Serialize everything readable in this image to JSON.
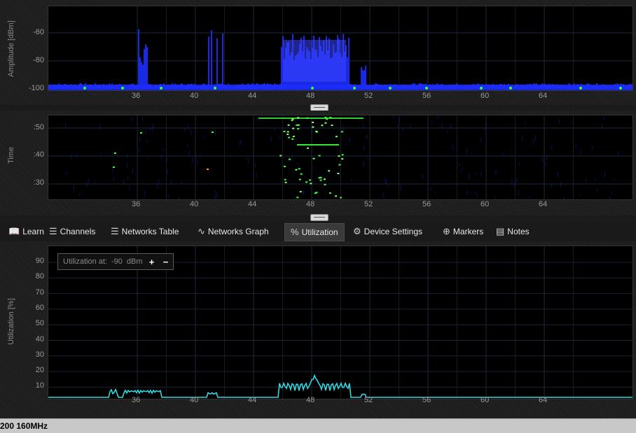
{
  "amplitude": {
    "ylabel": "Amplitude [dBm]",
    "yticks": [
      "-60",
      "-80",
      "-100"
    ],
    "xticks": [
      "36",
      "40",
      "44",
      "48",
      "52",
      "56",
      "60",
      "64"
    ]
  },
  "time": {
    "ylabel": "Time",
    "yticks": [
      ":50",
      ":40",
      ":30"
    ],
    "xticks": [
      "36",
      "40",
      "44",
      "48",
      "52",
      "56",
      "60",
      "64"
    ]
  },
  "tabs": [
    {
      "label": "Learn",
      "icon": "book-icon"
    },
    {
      "label": "Channels",
      "icon": "channels-icon"
    },
    {
      "label": "Networks Table",
      "icon": "wifi-icon"
    },
    {
      "label": "Networks Graph",
      "icon": "graph-icon"
    },
    {
      "label": "Utilization",
      "icon": "percent-icon"
    },
    {
      "label": "Device Settings",
      "icon": "gears-icon"
    },
    {
      "label": "Markers",
      "icon": "crosshair-icon"
    },
    {
      "label": "Notes",
      "icon": "notes-icon"
    }
  ],
  "active_tab": "Utilization",
  "utilization": {
    "ylabel": "Utilization [%]",
    "yticks": [
      "90",
      "80",
      "70",
      "60",
      "50",
      "40",
      "30",
      "20",
      "10"
    ],
    "xticks": [
      "36",
      "40",
      "44",
      "48",
      "52",
      "56",
      "60",
      "64"
    ],
    "control": {
      "label": "Utilization at:",
      "value": "-90",
      "unit": "dBm",
      "plus": "+",
      "minus": "−"
    }
  },
  "status_text": "200 160MHz",
  "colors": {
    "trace": "#34d6e0",
    "spectrum": "#1a2cff",
    "hot": "#39ff39"
  }
}
